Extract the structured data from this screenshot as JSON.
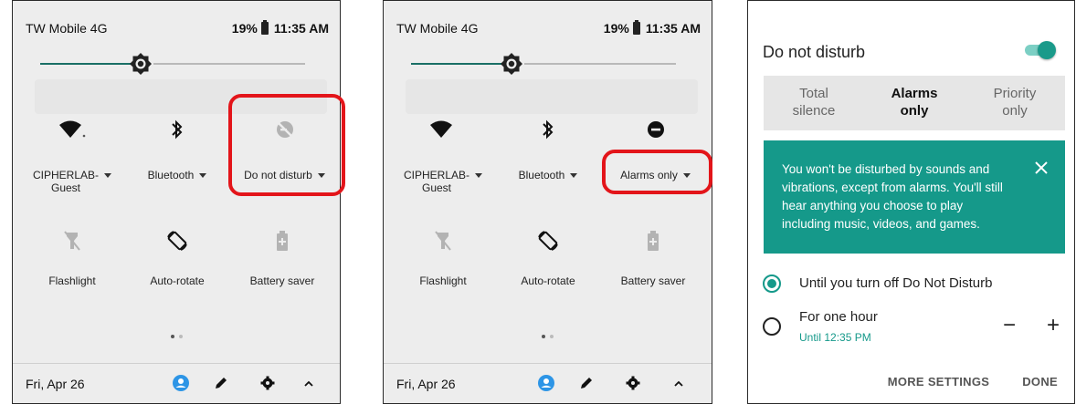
{
  "panels": [
    {
      "status": {
        "carrier": "TW Mobile 4G",
        "battery": "19%",
        "time": "11:35 AM"
      },
      "brightness": 0.38,
      "tiles": [
        {
          "label": "CIPHERLAB-\nGuest",
          "icon": "wifi-icon"
        },
        {
          "label": "Bluetooth",
          "icon": "bluetooth-icon"
        },
        {
          "label": "Do not disturb",
          "icon": "do-not-disturb-off-icon"
        },
        {
          "label": "Flashlight",
          "icon": "flashlight-off-icon"
        },
        {
          "label": "Auto-rotate",
          "icon": "auto-rotate-icon"
        },
        {
          "label": "Battery saver",
          "icon": "battery-saver-icon"
        }
      ],
      "footer": {
        "date": "Fri, Apr 26"
      }
    },
    {
      "status": {
        "carrier": "TW Mobile 4G",
        "battery": "19%",
        "time": "11:35 AM"
      },
      "brightness": 0.38,
      "tiles": [
        {
          "label": "CIPHERLAB-\nGuest",
          "icon": "wifi-icon"
        },
        {
          "label": "Bluetooth",
          "icon": "bluetooth-icon"
        },
        {
          "label": "Alarms only",
          "icon": "do-not-disturb-on-icon"
        },
        {
          "label": "Flashlight",
          "icon": "flashlight-off-icon"
        },
        {
          "label": "Auto-rotate",
          "icon": "auto-rotate-icon"
        },
        {
          "label": "Battery saver",
          "icon": "battery-saver-icon"
        }
      ],
      "footer": {
        "date": "Fri, Apr 26"
      }
    }
  ],
  "dialog": {
    "title": "Do not disturb",
    "enabled": true,
    "modes": [
      {
        "line1": "Total",
        "line2": "silence"
      },
      {
        "line1": "Alarms",
        "line2": "only",
        "selected": true
      },
      {
        "line1": "Priority",
        "line2": "only"
      }
    ],
    "info": "You won't be disturbed by sounds and vibrations, except from alarms. You'll still hear anything you choose to play including music, videos, and games.",
    "option1": "Until you turn off Do Not Disturb",
    "option2": "For one hour",
    "option2_sub": "Until 12:35 PM",
    "stepper_minus": "−",
    "stepper_plus": "+",
    "more_settings": "MORE SETTINGS",
    "done": "DONE"
  },
  "colors": {
    "accent": "#15998a",
    "highlight": "#e3151a",
    "slider": "#1a6f66"
  }
}
